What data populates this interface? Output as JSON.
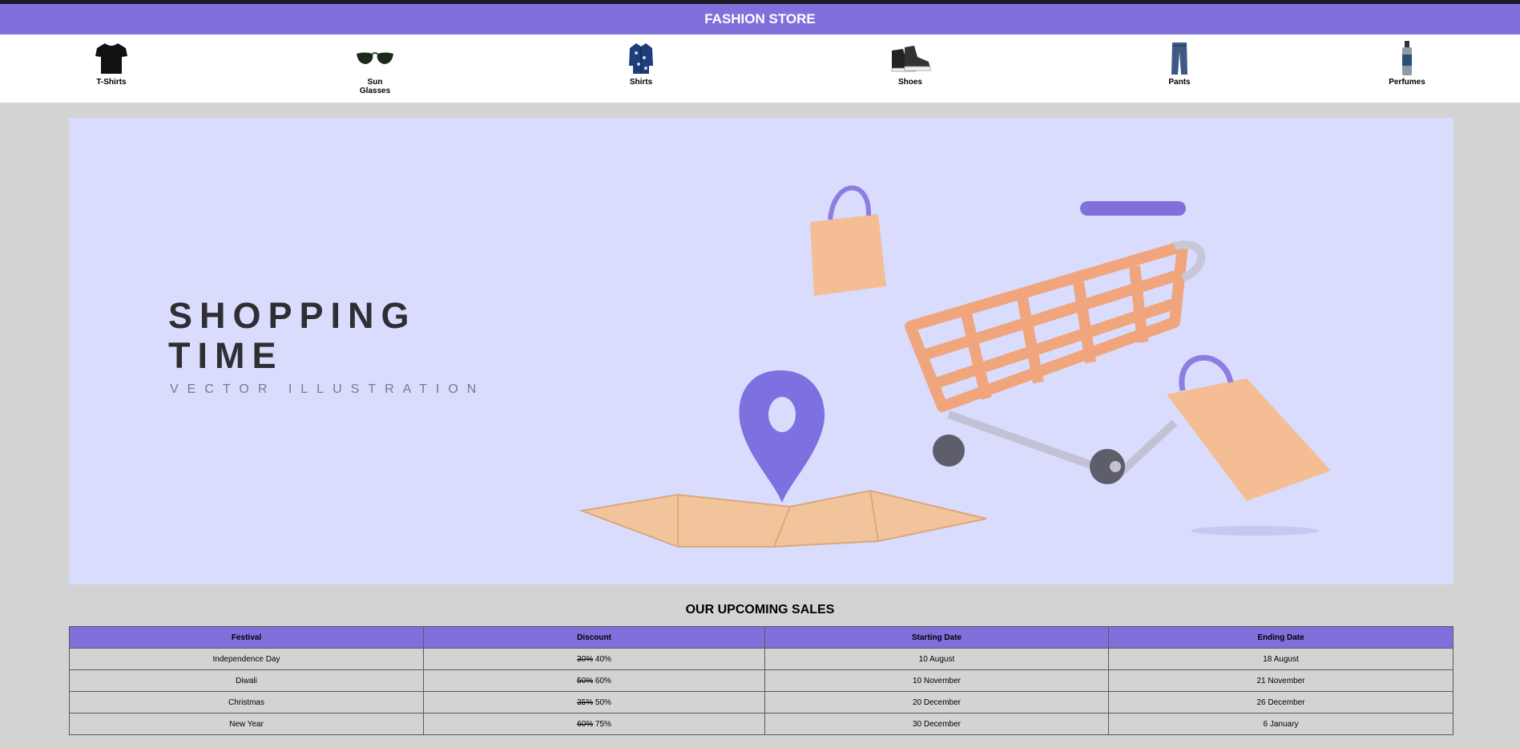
{
  "header": {
    "title": "FASHION STORE"
  },
  "categories": [
    {
      "label": "T-Shirts",
      "icon": "tshirt-icon"
    },
    {
      "label": "Sun Glasses",
      "icon": "sunglasses-icon"
    },
    {
      "label": "Shirts",
      "icon": "shirt-icon"
    },
    {
      "label": "Shoes",
      "icon": "shoes-icon"
    },
    {
      "label": "Pants",
      "icon": "pants-icon"
    },
    {
      "label": "Perfumes",
      "icon": "perfume-icon"
    }
  ],
  "hero": {
    "line1": "SHOPPING",
    "line2": "TIME",
    "subtitle": "VECTOR ILLUSTRATION"
  },
  "sales": {
    "title": "OUR UPCOMING SALES",
    "headers": [
      "Festival",
      "Discount",
      "Starting Date",
      "Ending Date"
    ],
    "rows": [
      {
        "festival": "Independence Day",
        "old_discount": "30%",
        "new_discount": "40%",
        "start": "10 August",
        "end": "18 August"
      },
      {
        "festival": "Diwali",
        "old_discount": "50%",
        "new_discount": "60%",
        "start": "10 November",
        "end": "21 November"
      },
      {
        "festival": "Christmas",
        "old_discount": "35%",
        "new_discount": "50%",
        "start": "20 December",
        "end": "26 December"
      },
      {
        "festival": "New Year",
        "old_discount": "60%",
        "new_discount": "75%",
        "start": "30 December",
        "end": "6 January"
      }
    ]
  },
  "colors": {
    "accent": "#8070dc",
    "hero_bg": "#d9dcfd",
    "page_bg": "#d3d3d3"
  }
}
